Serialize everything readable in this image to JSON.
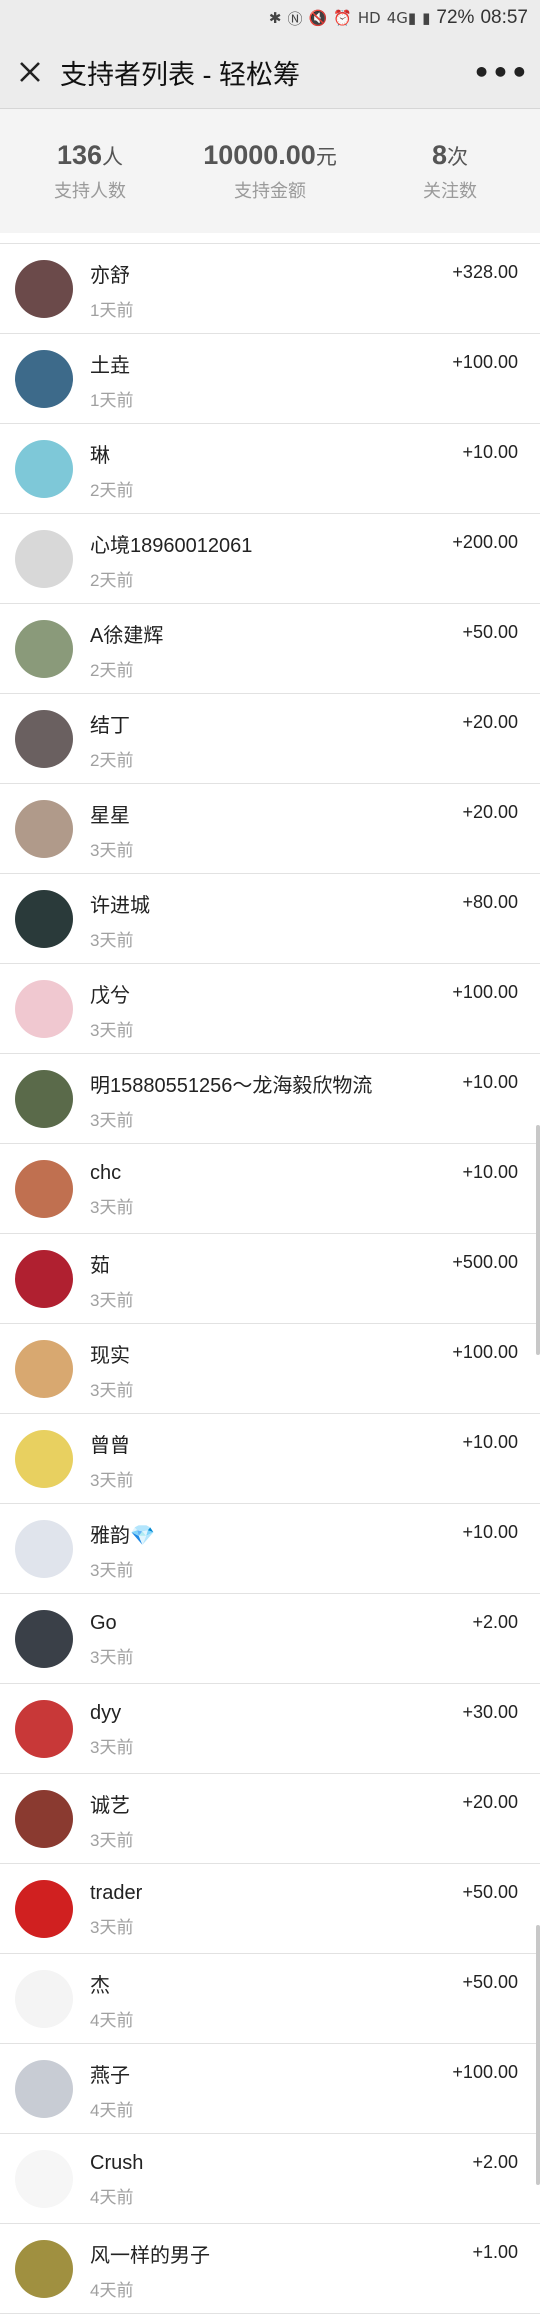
{
  "status_bar": {
    "battery": "72%",
    "time": "08:57",
    "icons": [
      "bluetooth-icon",
      "nfc-icon",
      "mute-icon",
      "alarm-icon",
      "hd-icon",
      "signal-4g-icon",
      "signal-icon"
    ]
  },
  "header": {
    "title": "支持者列表 - 轻松筹",
    "close_icon": "close-icon",
    "more_icon": "more-icon"
  },
  "stats": [
    {
      "value": "136",
      "unit": "人",
      "label": "支持人数"
    },
    {
      "value": "10000.00",
      "unit": "元",
      "label": "支持金额"
    },
    {
      "value": "8",
      "unit": "次",
      "label": "关注数"
    }
  ],
  "supporters": [
    {
      "name": "亦舒",
      "time": "1天前",
      "amount": "+328.00",
      "color": "#6b4a4a"
    },
    {
      "name": "土垚",
      "time": "1天前",
      "amount": "+100.00",
      "color": "#3d6a8a"
    },
    {
      "name": "琳",
      "time": "2天前",
      "amount": "+10.00",
      "color": "#7ec8d8"
    },
    {
      "name": "心境18960012061",
      "time": "2天前",
      "amount": "+200.00",
      "color": "#d8d8d8"
    },
    {
      "name": "A徐建辉",
      "time": "2天前",
      "amount": "+50.00",
      "color": "#8a9a7a"
    },
    {
      "name": "结丁",
      "time": "2天前",
      "amount": "+20.00",
      "color": "#6a6060"
    },
    {
      "name": "星星",
      "time": "3天前",
      "amount": "+20.00",
      "color": "#b09a8a"
    },
    {
      "name": "许进城",
      "time": "3天前",
      "amount": "+80.00",
      "color": "#2a3a3a"
    },
    {
      "name": "戊兮",
      "time": "3天前",
      "amount": "+100.00",
      "color": "#f0c8d0"
    },
    {
      "name": "明15880551256～龙海毅欣物流",
      "time": "3天前",
      "amount": "+10.00",
      "color": "#5a6a4a"
    },
    {
      "name": "chc",
      "time": "3天前",
      "amount": "+10.00",
      "color": "#c07050"
    },
    {
      "name": "茹",
      "time": "3天前",
      "amount": "+500.00",
      "color": "#b02030"
    },
    {
      "name": "现实",
      "time": "3天前",
      "amount": "+100.00",
      "color": "#d8a870"
    },
    {
      "name": "曾曾",
      "time": "3天前",
      "amount": "+10.00",
      "color": "#e8d060"
    },
    {
      "name": "雅韵💎",
      "time": "3天前",
      "amount": "+10.00",
      "color": "#e0e4ec"
    },
    {
      "name": "Go",
      "time": "3天前",
      "amount": "+2.00",
      "color": "#3a4048"
    },
    {
      "name": "dyy",
      "time": "3天前",
      "amount": "+30.00",
      "color": "#c83838"
    },
    {
      "name": "诚艺",
      "time": "3天前",
      "amount": "+20.00",
      "color": "#8a3a30"
    },
    {
      "name": "trader",
      "time": "3天前",
      "amount": "+50.00",
      "color": "#d02020"
    },
    {
      "name": "杰",
      "time": "4天前",
      "amount": "+50.00",
      "color": "#f4f4f4"
    },
    {
      "name": "燕子",
      "time": "4天前",
      "amount": "+100.00",
      "color": "#c8ccd4"
    },
    {
      "name": "Crush",
      "time": "4天前",
      "amount": "+2.00",
      "color": "#f6f6f6"
    },
    {
      "name": "风一样的男子",
      "time": "4天前",
      "amount": "+1.00",
      "color": "#a09040"
    }
  ]
}
